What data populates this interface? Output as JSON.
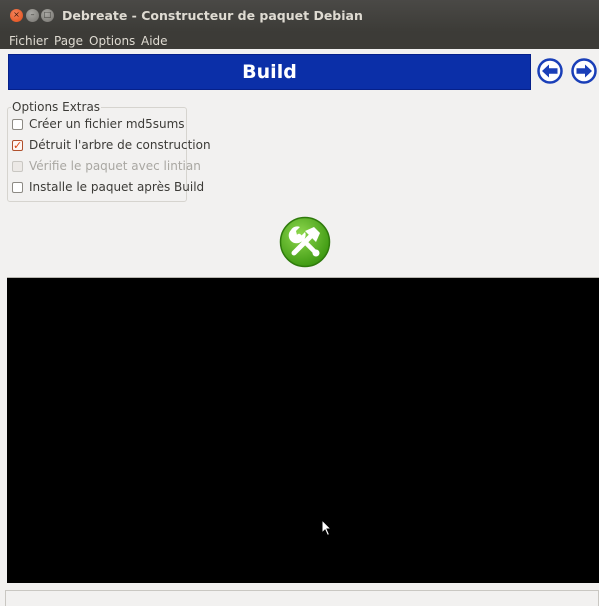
{
  "window": {
    "title": "Debreate - Constructeur de paquet Debian",
    "controls": {
      "close": "×",
      "minimize": "–",
      "maximize": "□"
    }
  },
  "menubar": {
    "items": [
      "Fichier",
      "Page",
      "Options",
      "Aide"
    ]
  },
  "banner": {
    "title": "Build",
    "color": "#0b2fa8"
  },
  "nav": {
    "prev_icon": "left-arrow-circle-icon",
    "next_icon": "right-arrow-circle-icon"
  },
  "options": {
    "group_label": "Options Extras",
    "items": [
      {
        "label": "Créer un fichier md5sums",
        "checked": false,
        "enabled": true
      },
      {
        "label": "Détruit l'arbre de construction",
        "checked": true,
        "enabled": true
      },
      {
        "label": "Vérifie le paquet avec lintian",
        "checked": false,
        "enabled": false
      },
      {
        "label": "Installe le paquet après Build",
        "checked": false,
        "enabled": true
      }
    ]
  },
  "build_button": {
    "icon": "build-tools-icon",
    "color": "#4caa1c"
  },
  "terminal": {
    "background": "#000000"
  }
}
